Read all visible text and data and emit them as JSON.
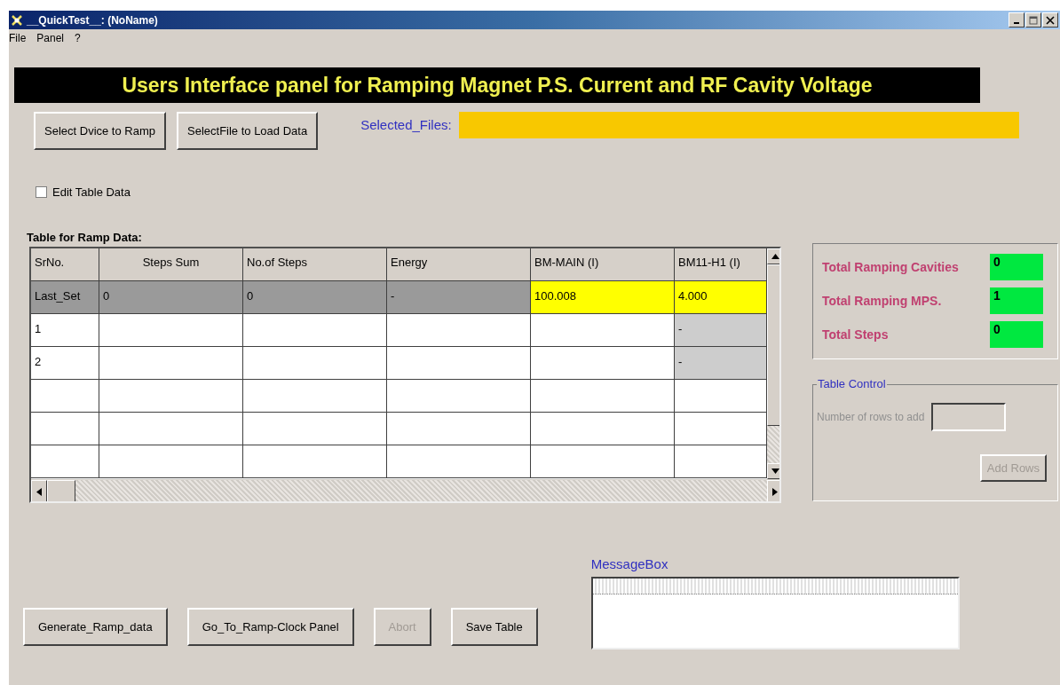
{
  "window": {
    "title": "__QuickTest__: (NoName)"
  },
  "menu": [
    "File",
    "Panel",
    "?"
  ],
  "banner": "Users Interface panel for Ramping Magnet P.S. Current and RF Cavity Voltage",
  "top_buttons": [
    {
      "label": "Select Dvice to Ramp",
      "disabled": false
    },
    {
      "label": "SelectFile to Load Data",
      "disabled": false
    }
  ],
  "selected_files": {
    "label": "Selected_Files:"
  },
  "edit_table_data": {
    "label": "Edit Table Data",
    "checked": false
  },
  "table": {
    "title": "Table for Ramp Data:",
    "columns": [
      "SrNo.",
      "Steps Sum",
      "No.of Steps",
      "Energy",
      "BM-MAIN (I)",
      "BM11-H1 (I)"
    ],
    "rows": [
      {
        "cells": [
          {
            "text": "Last_Set",
            "kind": "set"
          },
          {
            "text": "0",
            "kind": "set"
          },
          {
            "text": "0",
            "kind": "set"
          },
          {
            "text": "-",
            "kind": "set"
          },
          {
            "text": "100.008",
            "kind": "current"
          },
          {
            "text": "4.000",
            "kind": "current"
          }
        ]
      },
      {
        "cells": [
          {
            "text": "1",
            "kind": "plain"
          },
          {
            "kind": "plain"
          },
          {
            "kind": "plain"
          },
          {
            "kind": "plain"
          },
          {
            "kind": "plain"
          },
          {
            "text": "-",
            "kind": "locked"
          }
        ]
      },
      {
        "cells": [
          {
            "text": "2",
            "kind": "plain"
          },
          {
            "kind": "plain"
          },
          {
            "kind": "plain"
          },
          {
            "kind": "plain"
          },
          {
            "kind": "plain"
          },
          {
            "text": "-",
            "kind": "locked"
          }
        ]
      },
      {
        "cells": [
          {
            "kind": "plain"
          },
          {
            "kind": "plain"
          },
          {
            "kind": "plain"
          },
          {
            "kind": "plain"
          },
          {
            "kind": "plain"
          },
          {
            "kind": "plain"
          }
        ]
      },
      {
        "cells": [
          {
            "kind": "plain"
          },
          {
            "kind": "plain"
          },
          {
            "kind": "plain"
          },
          {
            "kind": "plain"
          },
          {
            "kind": "plain"
          },
          {
            "kind": "plain"
          }
        ]
      },
      {
        "cells": [
          {
            "kind": "plain"
          },
          {
            "kind": "plain"
          },
          {
            "kind": "plain"
          },
          {
            "kind": "plain"
          },
          {
            "kind": "plain"
          },
          {
            "kind": "plain"
          }
        ]
      }
    ]
  },
  "totals": [
    {
      "label": "Total Ramping Cavities",
      "value": "0"
    },
    {
      "label": "Total Ramping MPS.",
      "value": "1"
    },
    {
      "label": "Total Steps",
      "value": "0"
    }
  ],
  "table_control": {
    "title": "Table Control",
    "rows_label": "Number of rows to add",
    "add_button": {
      "label": "Add Rows",
      "disabled": true
    }
  },
  "message_box": {
    "label": "MessageBox"
  },
  "bottom_buttons": [
    {
      "label": "Generate_Ramp_data",
      "disabled": false
    },
    {
      "label": "Go_To_Ramp-Clock Panel",
      "disabled": false
    },
    {
      "label": "Abort",
      "disabled": true
    },
    {
      "label": "Save Table",
      "disabled": false
    }
  ]
}
